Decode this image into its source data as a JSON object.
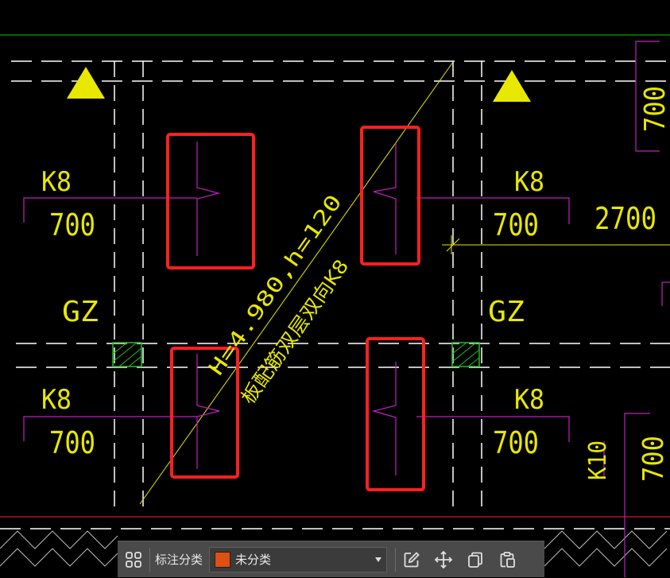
{
  "drawing": {
    "labels": {
      "k8": "K8",
      "dim_700": "700",
      "dim_2700": "2700",
      "gz": "GZ",
      "k10": "K10",
      "slab_line1": "H=4.980,h=120",
      "slab_line2": "板配筋双层双向K8"
    },
    "colors": {
      "background": "#000000",
      "text_yellow": "#e8e800",
      "rebar_magenta": "#c020c0",
      "axis_white": "#ffffff",
      "highlight_red": "#ff2020",
      "hatch_green": "#20c020",
      "edge_green": "#00d000",
      "edge_red": "#ff2040"
    }
  },
  "toolbar": {
    "group_icon": "grid-group-icon",
    "label": "标注分类",
    "category_value": "未分类",
    "category_color": "#e05010",
    "edit_icon": "edit-icon",
    "move_icon": "move-icon",
    "copy_icon": "copy-icon",
    "paste_icon": "paste-icon"
  }
}
